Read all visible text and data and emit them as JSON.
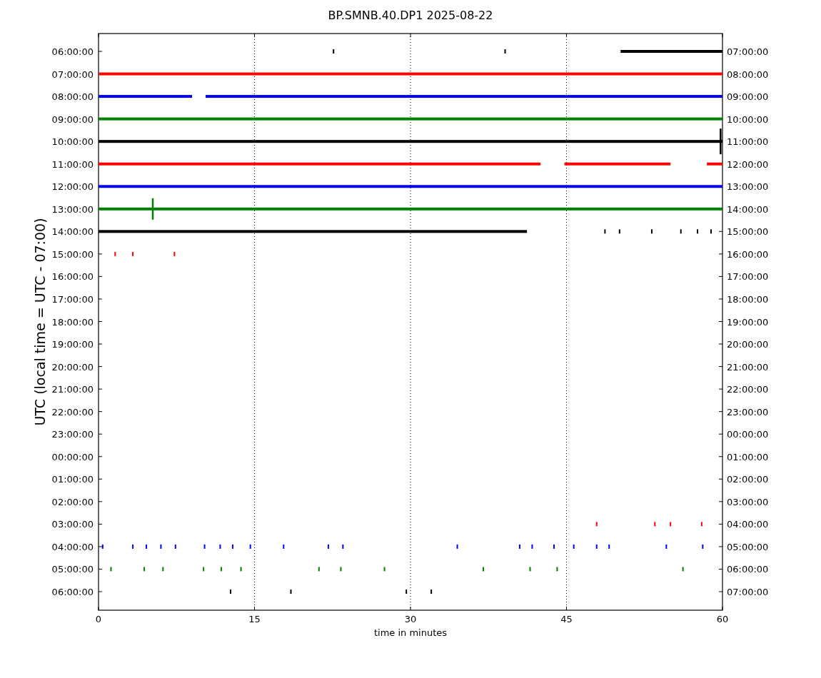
{
  "title": "BP.SMNB.40.DP1 2025-08-22",
  "ylabel": "UTC (local time = UTC - 07:00)",
  "xlabel": "time in minutes",
  "x_ticks": [
    "0",
    "15",
    "30",
    "45",
    "60"
  ],
  "rows": [
    {
      "left": "06:00:00",
      "right": "07:00:00",
      "color": "#000000"
    },
    {
      "left": "07:00:00",
      "right": "08:00:00",
      "color": "#ff0000"
    },
    {
      "left": "08:00:00",
      "right": "09:00:00",
      "color": "#0000ff"
    },
    {
      "left": "09:00:00",
      "right": "10:00:00",
      "color": "#008000"
    },
    {
      "left": "10:00:00",
      "right": "11:00:00",
      "color": "#000000"
    },
    {
      "left": "11:00:00",
      "right": "12:00:00",
      "color": "#ff0000"
    },
    {
      "left": "12:00:00",
      "right": "13:00:00",
      "color": "#0000ff"
    },
    {
      "left": "13:00:00",
      "right": "14:00:00",
      "color": "#008000"
    },
    {
      "left": "14:00:00",
      "right": "15:00:00",
      "color": "#000000"
    },
    {
      "left": "15:00:00",
      "right": "16:00:00",
      "color": "#ff0000"
    },
    {
      "left": "16:00:00",
      "right": "17:00:00"
    },
    {
      "left": "17:00:00",
      "right": "18:00:00"
    },
    {
      "left": "18:00:00",
      "right": "19:00:00"
    },
    {
      "left": "19:00:00",
      "right": "20:00:00"
    },
    {
      "left": "20:00:00",
      "right": "21:00:00"
    },
    {
      "left": "21:00:00",
      "right": "22:00:00"
    },
    {
      "left": "22:00:00",
      "right": "23:00:00"
    },
    {
      "left": "23:00:00",
      "right": "00:00:00"
    },
    {
      "left": "00:00:00",
      "right": "01:00:00"
    },
    {
      "left": "01:00:00",
      "right": "02:00:00"
    },
    {
      "left": "02:00:00",
      "right": "03:00:00"
    },
    {
      "left": "03:00:00",
      "right": "04:00:00",
      "color": "#ff0000"
    },
    {
      "left": "04:00:00",
      "right": "05:00:00",
      "color": "#0000ff"
    },
    {
      "left": "05:00:00",
      "right": "06:00:00",
      "color": "#008000"
    },
    {
      "left": "06:00:00",
      "right": "07:00:00",
      "color": "#000000"
    }
  ]
}
